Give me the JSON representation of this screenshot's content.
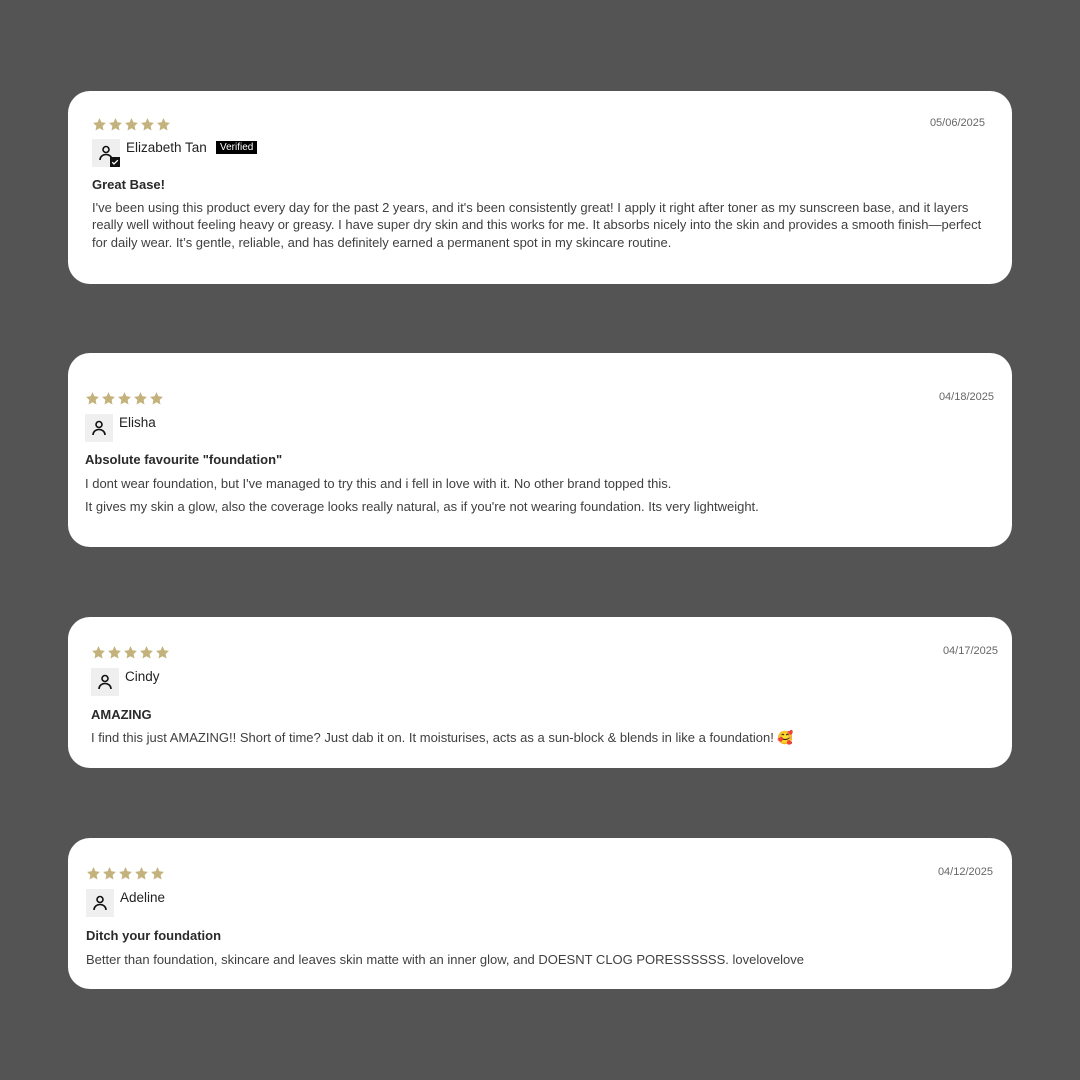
{
  "colors": {
    "background": "#545454",
    "card": "#ffffff",
    "star": "#c4b27c",
    "verified_badge": "#000000"
  },
  "reviews": [
    {
      "rating": 5,
      "date": "05/06/2025",
      "author": "Elizabeth Tan",
      "verified_label": "Verified",
      "title": "Great Base!",
      "body": [
        "I've been using this product every day for the past 2 years, and it's been consistently great! I apply it right after toner as my sunscreen base, and it layers really well without feeling heavy or greasy. I have super dry skin and this works for me. It absorbs nicely into the skin and provides a smooth finish—perfect for daily wear. It’s gentle, reliable, and has definitely earned a permanent spot in my skincare routine."
      ]
    },
    {
      "rating": 5,
      "date": "04/18/2025",
      "author": "Elisha",
      "title": "Absolute favourite \"foundation\"",
      "body": [
        "I dont wear foundation, but I've managed to try this and i fell in love with it. No other brand topped this.",
        "It gives my skin a glow, also the coverage looks really natural, as if you're not wearing foundation. Its very lightweight."
      ]
    },
    {
      "rating": 5,
      "date": "04/17/2025",
      "author": "Cindy",
      "title": "AMAZING",
      "body": [
        "I find this just AMAZING!! Short of time? Just dab it on. It moisturises, acts as a sun-block & blends in like a foundation! 🥰"
      ]
    },
    {
      "rating": 5,
      "date": "04/12/2025",
      "author": "Adeline",
      "title": "Ditch your foundation",
      "body": [
        "Better than foundation, skincare and leaves skin matte with an inner glow, and DOESNT CLOG PORESSSSSS. lovelovelove"
      ]
    }
  ],
  "icons": {
    "rating": "star-icon",
    "avatar": "user-icon",
    "verified_check": "check-icon"
  }
}
